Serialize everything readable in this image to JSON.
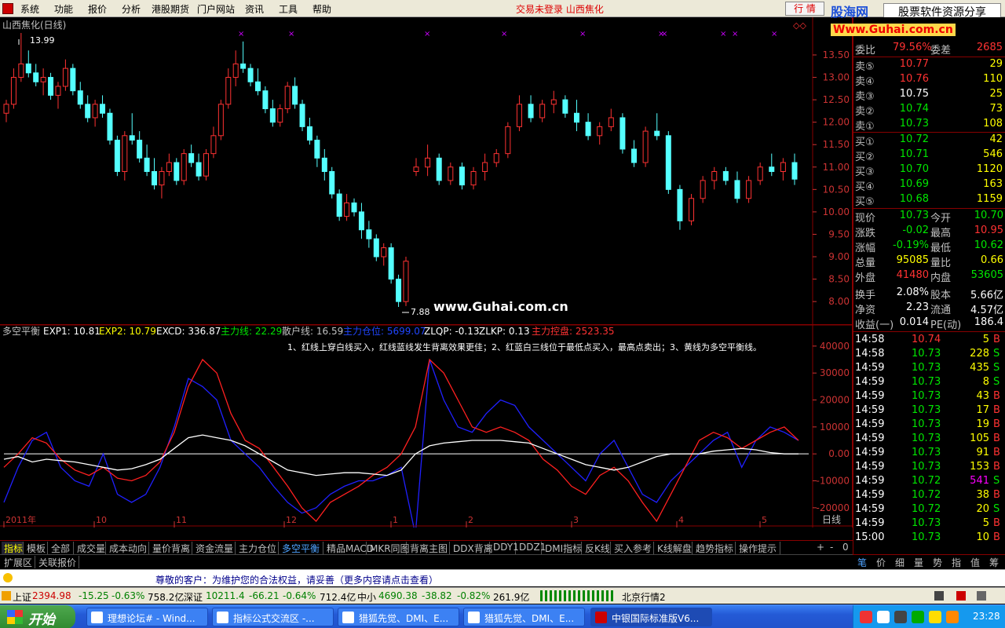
{
  "menubar": {
    "items": [
      "系统",
      "功能",
      "报价",
      "分析",
      "港股期货",
      "门户网站",
      "资讯",
      "工具",
      "帮助"
    ],
    "notice": "交易未登录  山西焦化",
    "hq_button": "行  情",
    "brand_name": "股海网",
    "brand_slogan": "股票软件资源分享",
    "brand_url": "Www.Guhai.com.cn"
  },
  "main_chart": {
    "title": "山西焦化(日线)",
    "high_label": "13.99",
    "low_label": "7.88",
    "watermark": "www.Guhai.com.cn",
    "y_ticks": [
      "13.50",
      "13.00",
      "12.50",
      "12.00",
      "11.50",
      "11.00",
      "10.50",
      "10.00",
      "9.50",
      "9.00",
      "8.50",
      "8.00"
    ],
    "up_color": "#ff3232",
    "down_color": "#54ffff"
  },
  "indicator": {
    "name": "多空平衡",
    "exp1": "EXP1: 10.81",
    "exp2": "EXP2: 10.79",
    "excd": "EXCD: 336.87",
    "zlx": "主力线: 22.29",
    "shx": "散户线: 16.59",
    "zlcw": "主力仓位: 5699.07",
    "zlqp": "ZLQP: -0.13",
    "zlkp": "ZLKP: 0.13",
    "zlkp2": "主力控盘: 2523.35",
    "note": "1、红线上穿白线买入，红线蓝线发生背离效果更佳；2、红蓝白三线位于最低点买入，最高点卖出；3、黄线为多空平衡线。",
    "y_ticks": [
      "40000",
      "30000",
      "20000",
      "10000",
      "0.00",
      "-10000",
      "-20000"
    ]
  },
  "x_axis": {
    "labels": [
      "2011年",
      "10",
      "11",
      "12",
      "1",
      "2",
      "3",
      "4",
      "5"
    ],
    "period": "日线"
  },
  "quote": {
    "wei_bi_label": "委比",
    "wei_bi": "79.56%",
    "wei_cha_label": "委差",
    "wei_cha": "2685",
    "sell": [
      {
        "label": "卖⑤",
        "price": "10.77",
        "vol": "29"
      },
      {
        "label": "卖④",
        "price": "10.76",
        "vol": "110"
      },
      {
        "label": "卖③",
        "price": "10.75",
        "vol": "25"
      },
      {
        "label": "卖②",
        "price": "10.74",
        "vol": "73"
      },
      {
        "label": "卖①",
        "price": "10.73",
        "vol": "108"
      }
    ],
    "buy": [
      {
        "label": "买①",
        "price": "10.72",
        "vol": "42"
      },
      {
        "label": "买②",
        "price": "10.71",
        "vol": "546"
      },
      {
        "label": "买③",
        "price": "10.70",
        "vol": "1120"
      },
      {
        "label": "买④",
        "price": "10.69",
        "vol": "163"
      },
      {
        "label": "买⑤",
        "price": "10.68",
        "vol": "1159"
      }
    ],
    "stats": [
      {
        "l1": "现价",
        "v1": "10.73",
        "c1": "g",
        "l2": "今开",
        "v2": "10.70",
        "c2": "g"
      },
      {
        "l1": "涨跌",
        "v1": "-0.02",
        "c1": "g",
        "l2": "最高",
        "v2": "10.95",
        "c2": "r"
      },
      {
        "l1": "涨幅",
        "v1": "-0.19%",
        "c1": "g",
        "l2": "最低",
        "v2": "10.62",
        "c2": "g"
      },
      {
        "l1": "总量",
        "v1": "95085",
        "c1": "y",
        "l2": "量比",
        "v2": "0.66",
        "c2": "y"
      },
      {
        "l1": "外盘",
        "v1": "41480",
        "c1": "r",
        "l2": "内盘",
        "v2": "53605",
        "c2": "g"
      },
      {
        "l1": "换手",
        "v1": "2.08%",
        "c1": "w",
        "l2": "股本",
        "v2": "5.66亿",
        "c2": "w"
      },
      {
        "l1": "净资",
        "v1": "2.23",
        "c1": "w",
        "l2": "流通",
        "v2": "4.57亿",
        "c2": "w"
      },
      {
        "l1": "收益(一)",
        "v1": "0.014",
        "c1": "w",
        "l2": "PE(动)",
        "v2": "186.4",
        "c2": "w"
      }
    ],
    "ticks": [
      {
        "t": "14:58",
        "p": "10.74",
        "v": "5",
        "s": "B"
      },
      {
        "t": "14:58",
        "p": "10.73",
        "v": "228",
        "s": "S"
      },
      {
        "t": "14:59",
        "p": "10.73",
        "v": "435",
        "s": "S"
      },
      {
        "t": "14:59",
        "p": "10.73",
        "v": "8",
        "s": "S"
      },
      {
        "t": "14:59",
        "p": "10.73",
        "v": "43",
        "s": "B"
      },
      {
        "t": "14:59",
        "p": "10.73",
        "v": "17",
        "s": "B"
      },
      {
        "t": "14:59",
        "p": "10.73",
        "v": "19",
        "s": "B"
      },
      {
        "t": "14:59",
        "p": "10.73",
        "v": "105",
        "s": "B"
      },
      {
        "t": "14:59",
        "p": "10.73",
        "v": "91",
        "s": "B"
      },
      {
        "t": "14:59",
        "p": "10.73",
        "v": "153",
        "s": "B"
      },
      {
        "t": "14:59",
        "p": "10.72",
        "v": "541",
        "s": "S"
      },
      {
        "t": "14:59",
        "p": "10.72",
        "v": "38",
        "s": "B"
      },
      {
        "t": "14:59",
        "p": "10.72",
        "v": "20",
        "s": "S"
      },
      {
        "t": "14:59",
        "p": "10.73",
        "v": "5",
        "s": "B"
      },
      {
        "t": "15:00",
        "p": "10.73",
        "v": "10",
        "s": "B"
      }
    ]
  },
  "tabs": [
    "指标",
    "模板",
    "全部",
    "成交量",
    "成本动向",
    "量价背离",
    "资金流量",
    "主力仓位",
    "多空平衡",
    "精品MACD",
    "MKR同图",
    "背离主图",
    "DDX背离",
    "DDY1",
    "DDZ1",
    "DMI指标",
    "反K线",
    "买入参考",
    "K线解盘",
    "趋势指标",
    "操作提示"
  ],
  "tab_controls": [
    "+",
    "-",
    "0"
  ],
  "tabs2": [
    "扩展区",
    "关联报价"
  ],
  "right_tabs": [
    "笔",
    "价",
    "细",
    "量",
    "势",
    "指",
    "值",
    "筹"
  ],
  "notice_bar": "尊敬的客户：为维护您的合法权益，请妥善（更多内容请点击查看）",
  "status": {
    "sh_label": "上证",
    "sh_val": "2394.98",
    "sh_chg": "-15.25",
    "sh_pct": "-0.63%",
    "sh_amt": "758.2亿",
    "sz_label": "深证",
    "sz_val": "10211.4",
    "sz_chg": "-66.21",
    "sz_pct": "-0.64%",
    "sz_amt": "712.4亿",
    "zx_label": "中小",
    "zx_val": "4690.38",
    "zx_chg": "-38.82",
    "zx_pct": "-0.82%",
    "zx_amt": "261.9亿",
    "server": "北京行情2"
  },
  "taskbar": {
    "start": "开始",
    "tasks": [
      "理想论坛# - Wind...",
      "指标公式交流区 -...",
      "猎狐先觉、DMI、E...",
      "猎狐先觉、DMI、E...",
      "中银国际标准版V6..."
    ],
    "clock": "23:28"
  },
  "chart_data": {
    "type": "candlestick",
    "title": "山西焦化(日线)",
    "ylim": [
      7.6,
      14.2
    ],
    "high": 13.99,
    "low": 7.88,
    "ohlc": [
      [
        12.2,
        12.5,
        12.0,
        12.4
      ],
      [
        12.4,
        13.2,
        12.3,
        13.0
      ],
      [
        13.0,
        13.99,
        12.9,
        13.3
      ],
      [
        13.3,
        13.6,
        13.0,
        13.1
      ],
      [
        13.1,
        13.3,
        12.8,
        12.9
      ],
      [
        12.9,
        13.2,
        12.6,
        13.0
      ],
      [
        13.0,
        13.1,
        12.5,
        12.6
      ],
      [
        12.6,
        12.9,
        12.3,
        12.8
      ],
      [
        12.8,
        13.4,
        12.7,
        13.2
      ],
      [
        13.2,
        13.3,
        12.6,
        12.7
      ],
      [
        12.7,
        12.9,
        12.3,
        12.4
      ],
      [
        12.4,
        12.6,
        12.0,
        12.1
      ],
      [
        12.1,
        12.5,
        11.9,
        12.4
      ],
      [
        12.4,
        12.6,
        12.1,
        12.2
      ],
      [
        12.2,
        12.3,
        11.5,
        11.6
      ],
      [
        11.6,
        11.7,
        10.8,
        10.9
      ],
      [
        10.9,
        11.8,
        10.7,
        11.7
      ],
      [
        11.7,
        12.2,
        11.5,
        11.6
      ],
      [
        11.6,
        11.8,
        11.1,
        11.2
      ],
      [
        11.2,
        11.5,
        10.8,
        10.9
      ],
      [
        10.9,
        11.2,
        10.5,
        10.6
      ],
      [
        10.6,
        11.0,
        10.3,
        10.9
      ],
      [
        10.9,
        11.3,
        10.8,
        11.1
      ],
      [
        11.1,
        11.2,
        10.6,
        10.7
      ],
      [
        10.7,
        11.4,
        10.6,
        11.3
      ],
      [
        11.3,
        11.5,
        11.0,
        11.1
      ],
      [
        11.1,
        11.3,
        10.7,
        10.8
      ],
      [
        10.8,
        11.4,
        10.7,
        11.3
      ],
      [
        11.3,
        11.9,
        11.2,
        11.7
      ],
      [
        11.7,
        12.5,
        11.6,
        12.4
      ],
      [
        12.4,
        13.2,
        12.3,
        13.0
      ],
      [
        13.0,
        13.6,
        12.8,
        13.3
      ],
      [
        13.3,
        13.8,
        13.1,
        13.2
      ],
      [
        13.2,
        13.3,
        12.8,
        12.9
      ],
      [
        12.9,
        13.2,
        12.6,
        12.7
      ],
      [
        12.7,
        12.8,
        12.2,
        12.3
      ],
      [
        12.3,
        12.5,
        11.9,
        12.0
      ],
      [
        12.0,
        12.4,
        11.9,
        12.3
      ],
      [
        12.3,
        12.9,
        12.2,
        12.8
      ],
      [
        12.8,
        13.0,
        12.3,
        12.4
      ],
      [
        12.4,
        12.5,
        11.8,
        11.9
      ],
      [
        11.9,
        12.1,
        11.5,
        11.6
      ],
      [
        11.6,
        11.7,
        11.0,
        11.2
      ],
      [
        11.2,
        11.4,
        10.7,
        10.9
      ],
      [
        10.9,
        11.0,
        10.3,
        10.4
      ],
      [
        10.4,
        10.5,
        9.8,
        9.9
      ],
      [
        9.9,
        10.4,
        9.8,
        10.2
      ],
      [
        10.2,
        10.3,
        9.9,
        10.0
      ],
      [
        10.0,
        10.2,
        9.4,
        9.6
      ],
      [
        9.6,
        9.8,
        9.2,
        9.4
      ],
      [
        9.4,
        9.5,
        8.9,
        9.0
      ],
      [
        9.0,
        9.3,
        8.8,
        9.2
      ],
      [
        9.2,
        9.3,
        8.4,
        8.5
      ],
      [
        8.5,
        8.6,
        7.88,
        8.0
      ],
      [
        8.0,
        9.0,
        7.9,
        8.9
      ],
      [
        10.9,
        11.2,
        10.8,
        11.0
      ],
      [
        11.0,
        11.5,
        10.8,
        11.2
      ],
      [
        11.2,
        11.3,
        10.6,
        10.7
      ],
      [
        10.7,
        11.1,
        10.6,
        11.0
      ],
      [
        11.0,
        11.1,
        10.5,
        10.6
      ],
      [
        10.6,
        11.0,
        10.5,
        10.9
      ],
      [
        10.9,
        11.3,
        10.7,
        11.1
      ],
      [
        11.1,
        11.4,
        11.0,
        11.3
      ],
      [
        11.3,
        12.0,
        11.2,
        11.9
      ],
      [
        11.9,
        12.6,
        11.8,
        12.4
      ],
      [
        12.4,
        12.6,
        12.0,
        12.1
      ],
      [
        12.1,
        12.5,
        12.0,
        12.4
      ],
      [
        12.4,
        12.7,
        12.2,
        12.5
      ],
      [
        12.5,
        12.6,
        12.1,
        12.2
      ],
      [
        12.2,
        12.5,
        11.8,
        12.0
      ],
      [
        12.0,
        12.2,
        11.6,
        11.7
      ],
      [
        11.7,
        12.0,
        11.5,
        11.9
      ],
      [
        11.9,
        12.3,
        11.8,
        12.1
      ],
      [
        12.1,
        12.2,
        11.3,
        11.4
      ],
      [
        11.4,
        11.6,
        11.0,
        11.1
      ],
      [
        11.1,
        11.9,
        11.0,
        11.8
      ],
      [
        11.8,
        12.2,
        11.6,
        11.7
      ],
      [
        11.7,
        11.8,
        10.4,
        10.5
      ],
      [
        10.5,
        10.6,
        9.6,
        9.8
      ],
      [
        9.8,
        10.4,
        9.7,
        10.3
      ],
      [
        10.3,
        10.8,
        10.2,
        10.7
      ],
      [
        10.7,
        11.0,
        10.5,
        10.9
      ],
      [
        10.9,
        11.0,
        10.6,
        10.7
      ],
      [
        10.7,
        10.9,
        10.2,
        10.3
      ],
      [
        10.3,
        10.8,
        10.2,
        10.7
      ],
      [
        10.7,
        11.1,
        10.6,
        11.0
      ],
      [
        11.0,
        11.3,
        10.8,
        10.9
      ],
      [
        10.9,
        11.2,
        10.7,
        11.1
      ],
      [
        11.1,
        11.3,
        10.6,
        10.73
      ]
    ]
  }
}
